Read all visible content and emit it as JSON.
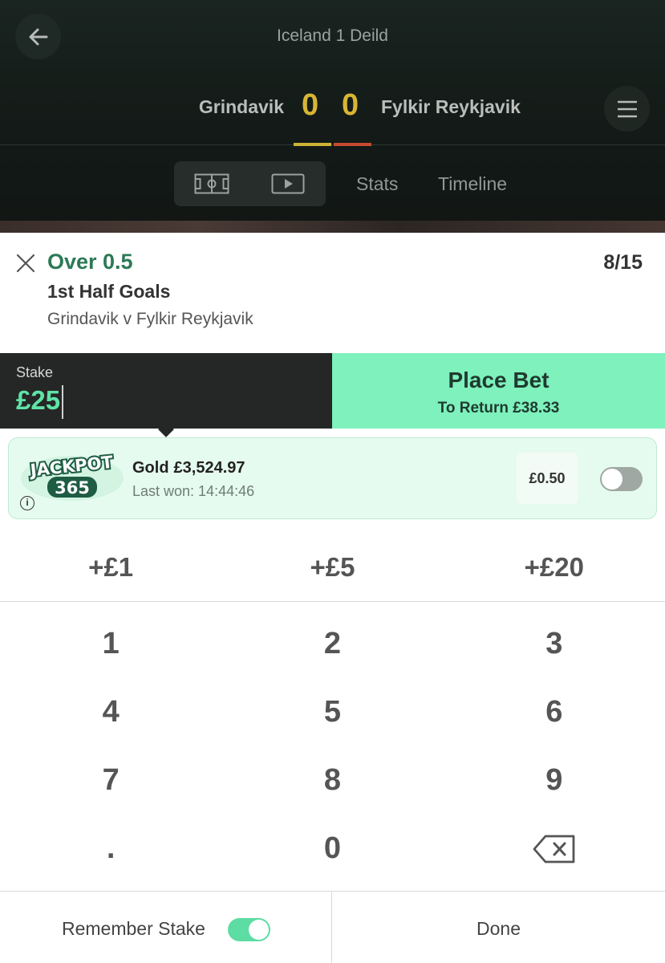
{
  "header": {
    "league": "Iceland 1 Deild",
    "home_team": "Grindavik",
    "away_team": "Fylkir Reykjavik",
    "home_score": "0",
    "away_score": "0",
    "tabs": [
      "Stats",
      "Timeline"
    ],
    "icons": {
      "back": "arrow-left-icon",
      "menu": "hamburger-menu-icon",
      "pitch": "pitch-icon",
      "video": "video-play-icon"
    },
    "colors": {
      "home": "#cdb336",
      "away": "#c44b2e"
    }
  },
  "selection": {
    "name": "Over 0.5",
    "market": "1st Half Goals",
    "event": "Grindavik v Fylkir Reykjavik",
    "odds": "8/15"
  },
  "stake": {
    "label": "Stake",
    "value": "£25"
  },
  "place_bet": {
    "label": "Place Bet",
    "return": "To Return £38.33"
  },
  "jackpot": {
    "logo_top": "JACKPOT",
    "logo_bottom": "365",
    "tier": "Gold",
    "amount": "£3,524.97",
    "last_won": "Last won: 14:44:46",
    "stake": "£0.50",
    "enabled": false,
    "info_glyph": "i"
  },
  "quick_stakes": [
    "+£1",
    "+£5",
    "+£20"
  ],
  "keypad": [
    [
      "1",
      "2",
      "3"
    ],
    [
      "4",
      "5",
      "6"
    ],
    [
      "7",
      "8",
      "9"
    ],
    [
      ".",
      "0",
      "backspace-icon"
    ]
  ],
  "footer": {
    "remember_label": "Remember Stake",
    "remember_enabled": true,
    "done_label": "Done"
  },
  "colors": {
    "brand_green": "#2c7a56",
    "place_bet_bg": "#7ef1bd",
    "stake_value": "#5fe3a7"
  }
}
